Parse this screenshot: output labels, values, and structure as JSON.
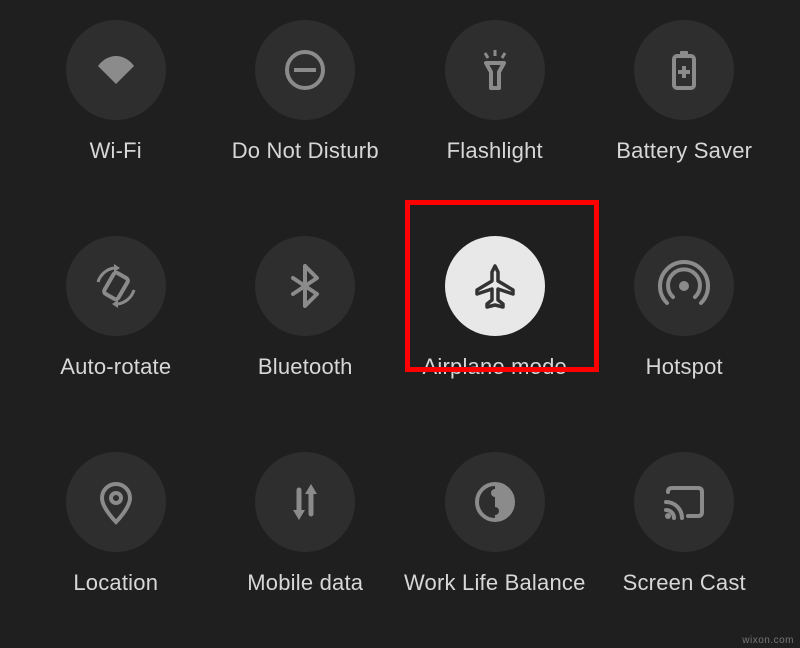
{
  "tiles": [
    {
      "id": "wifi",
      "label": "Wi-Fi",
      "active": false
    },
    {
      "id": "dnd",
      "label": "Do Not Disturb",
      "active": false
    },
    {
      "id": "flashlight",
      "label": "Flashlight",
      "active": false
    },
    {
      "id": "battery-saver",
      "label": "Battery Saver",
      "active": false
    },
    {
      "id": "auto-rotate",
      "label": "Auto-rotate",
      "active": false
    },
    {
      "id": "bluetooth",
      "label": "Bluetooth",
      "active": false
    },
    {
      "id": "airplane-mode",
      "label": "Airplane mode",
      "active": true
    },
    {
      "id": "hotspot",
      "label": "Hotspot",
      "active": false
    },
    {
      "id": "location",
      "label": "Location",
      "active": false
    },
    {
      "id": "mobile-data",
      "label": "Mobile data",
      "active": false
    },
    {
      "id": "work-life",
      "label": "Work Life Balance",
      "active": false
    },
    {
      "id": "screen-cast",
      "label": "Screen Cast",
      "active": false
    }
  ],
  "highlight_tile": "airplane-mode",
  "watermark": "wixon.com",
  "colors": {
    "bg": "#1f1f1f",
    "tile_off": "#2e2e2e",
    "tile_on": "#e8e8e8",
    "icon_off": "#8b8b8b",
    "icon_on": "#333333",
    "label": "#d7d7d7",
    "highlight": "#ff0000"
  }
}
